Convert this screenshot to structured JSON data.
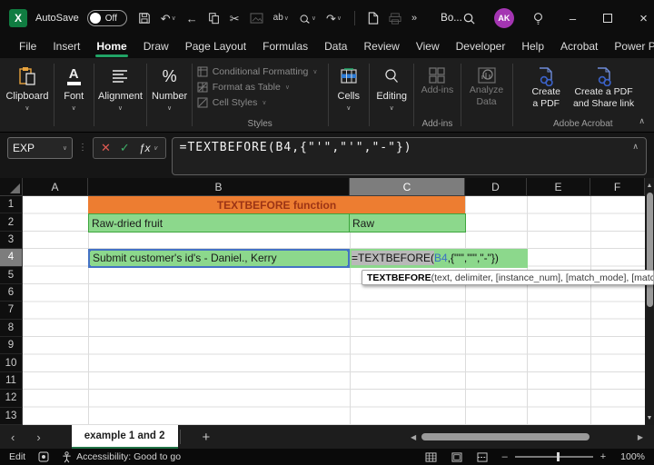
{
  "icons": {
    "chevron_down": "∨",
    "chevron_up": "∧",
    "overflow": "»",
    "ellipsis_v": "⋮",
    "nav_left": "‹",
    "nav_right": "›",
    "tri_left": "◀",
    "tri_right": "▶",
    "tri_up": "▲",
    "tri_down": "▼",
    "undo": "↶",
    "redo": "↷",
    "back_arrow": "←",
    "scissors": "✂",
    "minimize": "–",
    "close": "×",
    "plus": "+",
    "minus": "–",
    "cancel_x": "✕",
    "check": "✓"
  },
  "titlebar": {
    "autosave_label": "AutoSave",
    "autosave_state": "Off",
    "spelling_glyph": "ab",
    "doc_title": "Bo...",
    "avatar": "AK"
  },
  "tabs": {
    "items": [
      "File",
      "Insert",
      "Home",
      "Draw",
      "Page Layout",
      "Formulas",
      "Data",
      "Review",
      "View",
      "Developer",
      "Help",
      "Acrobat",
      "Power Pivot"
    ],
    "active": "Home"
  },
  "ribbon": {
    "clipboard": "Clipboard",
    "font": "Font",
    "font_glyph": "A",
    "alignment": "Alignment",
    "number": "Number",
    "number_glyph": "%",
    "styles_items": [
      "Conditional Formatting",
      "Format as Table",
      "Cell Styles"
    ],
    "styles_caption": "Styles",
    "cells": "Cells",
    "editing": "Editing",
    "addins_btn": "Add-ins",
    "addins_caption": "Add-ins",
    "analyze_line1": "Analyze",
    "analyze_line2": "Data",
    "pdf1_line1": "Create",
    "pdf1_line2": "a PDF",
    "pdf2_line1": "Create a PDF",
    "pdf2_line2": "and Share link",
    "acrobat_caption": "Adobe Acrobat"
  },
  "formula_bar": {
    "name_box": "EXP",
    "fx": "ƒx",
    "formula": "=TEXTBEFORE(B4,{\"'\",\"'\",\"-\"})"
  },
  "grid": {
    "columns": [
      "A",
      "B",
      "C",
      "D",
      "E",
      "F"
    ],
    "active_column": "C",
    "rows": [
      "1",
      "2",
      "3",
      "4",
      "5",
      "6",
      "7",
      "8",
      "9",
      "10",
      "11",
      "12",
      "13"
    ],
    "active_row": "4",
    "cells": {
      "b1_merged_title": "TEXTBEFORE function",
      "b2": "Raw-dried fruit",
      "c2": "Raw",
      "b4": "Submit customer's id's - Daniel., Kerry",
      "c4_prefix": "=TEXTBEFORE(",
      "c4_ref": "B4",
      "c4_suffix": ",{\"'\",\"'\",\"-\"})"
    },
    "tooltip_bold": "TEXTBEFORE",
    "tooltip_rest": "(text, delimiter, [instance_num], [match_mode], [match_end],"
  },
  "sheet_bar": {
    "tab_label": "example 1 and 2"
  },
  "status_bar": {
    "mode": "Edit",
    "accessibility": "Accessibility: Good to go",
    "zoom_level": "100%"
  },
  "colors": {
    "accent_green": "#21A366",
    "share_green": "#1F8A4F",
    "header_orange": "#ED7D31",
    "orange_text": "#9C3415",
    "cell_green": "#8CD88C",
    "cell_green_border": "#3DA53D",
    "reference_blue": "#4472C4",
    "avatar_purple": "#A435B2"
  }
}
